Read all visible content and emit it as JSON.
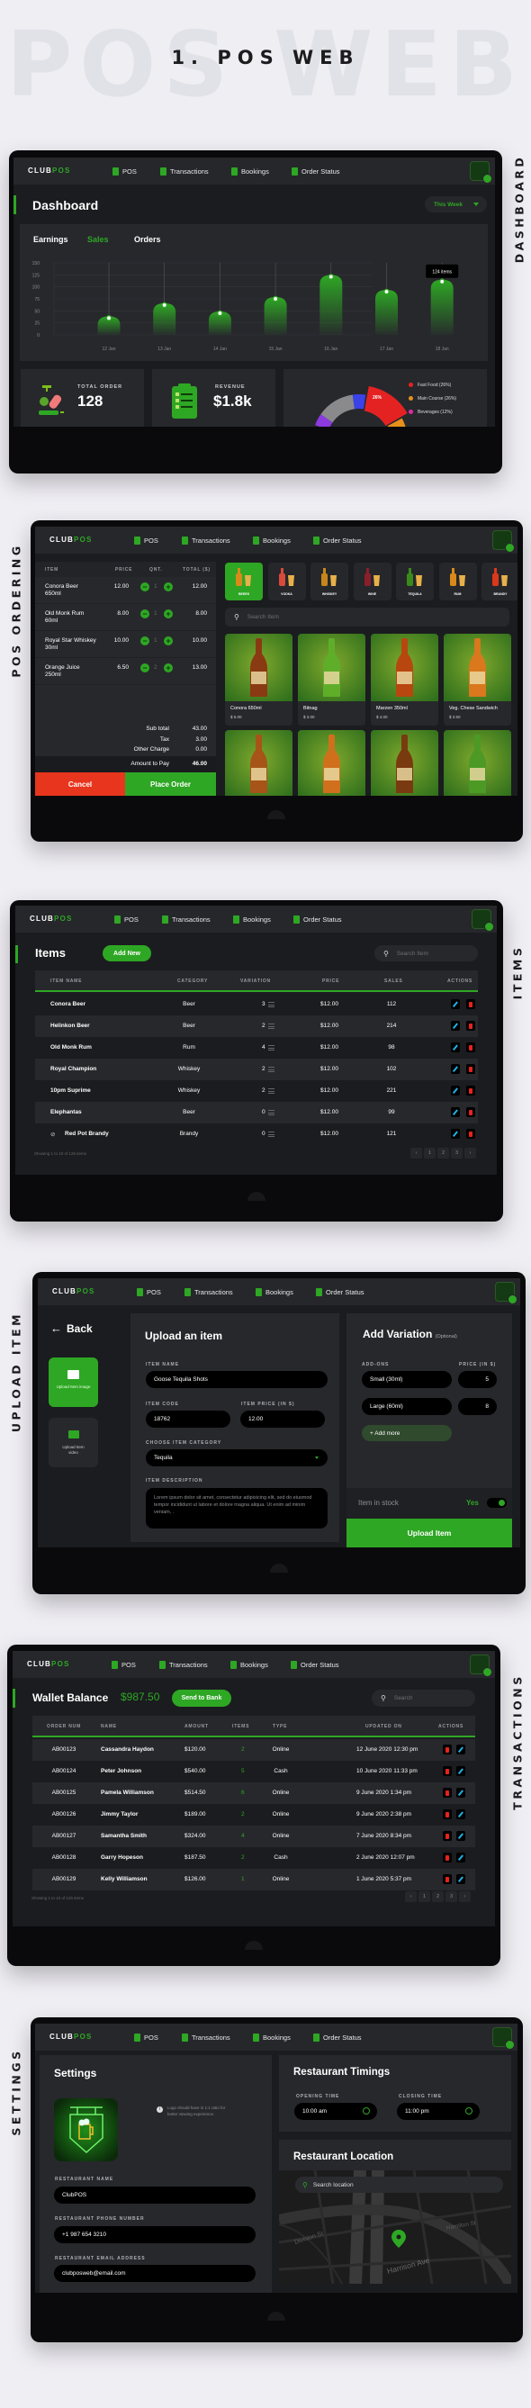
{
  "page": {
    "title": "1. POS WEB",
    "watermark": "POS WEB"
  },
  "section_labels": {
    "dashboard": "DASHBOARD",
    "ordering": "POS ORDERING",
    "items": "ITEMS",
    "upload": "UPLOAD ITEM",
    "transactions": "TRANSACTIONS",
    "settings": "SETTINGS"
  },
  "colors": {
    "accent": "#2ea724",
    "danger": "#e8351d",
    "edit": "#1fb3e8",
    "background": "#1b1c1f"
  },
  "nav": {
    "logo_a": "CLUB",
    "logo_b": "POS",
    "items": [
      {
        "label": "POS",
        "icon": "clipboard-icon"
      },
      {
        "label": "Transactions",
        "icon": "cards-icon"
      },
      {
        "label": "Bookings",
        "icon": "chair-icon"
      },
      {
        "label": "Order Status",
        "icon": "hourglass-icon"
      }
    ]
  },
  "dashboard": {
    "title": "Dashboard",
    "range": "This Week",
    "tabs": [
      "Earnings",
      "Sales",
      "Orders"
    ],
    "active_tab": "Sales",
    "tooltip": "124 items",
    "stats": {
      "total_order_label": "TOTAL ORDER",
      "total_order_value": "128",
      "revenue_label": "REVENUE",
      "revenue_value": "$1.8k"
    },
    "legend": [
      "Fast Food (26%)",
      "Main Course (26%)",
      "Beverages (12%)"
    ],
    "donut_label": "26%"
  },
  "chart_data": [
    {
      "type": "bar",
      "categories": [
        "12 Jan",
        "13 Jan",
        "14 Jan",
        "15 Jan",
        "16 Jan",
        "17 Jan",
        "18 Jan"
      ],
      "values": [
        35,
        62,
        45,
        75,
        121,
        90,
        111
      ],
      "yticks": [
        0,
        25,
        50,
        75,
        100,
        125,
        150
      ],
      "ylim": [
        0,
        150
      ],
      "grid": true,
      "annotation": {
        "category": "18 Jan",
        "text": "124 items"
      },
      "color": "#2ea724"
    },
    {
      "type": "pie",
      "donut": true,
      "legend": [
        "Fast Food (26%)",
        "Main Course (26%)",
        "Beverages (12%)"
      ],
      "legend_colors": [
        "#e52222",
        "#e8901a",
        "#e02aa8"
      ],
      "values": [
        26,
        26,
        12
      ],
      "slice_label": "26%",
      "legend_placement": "right"
    }
  ],
  "ordering": {
    "headers": [
      "ITEM",
      "PRICE",
      "QNT.",
      "TOTAL ($)"
    ],
    "rows": [
      {
        "name": "Conora Beer",
        "size": "650ml",
        "price": "12.00",
        "qty": "1",
        "total": "12.00"
      },
      {
        "name": "Old Monk Rum",
        "size": "60ml",
        "price": "8.00",
        "qty": "1",
        "total": "8.00"
      },
      {
        "name": "Royal Star Whiskey",
        "size": "30ml",
        "price": "10.00",
        "qty": "1",
        "total": "10.00"
      },
      {
        "name": "Orange Juice",
        "size": "250ml",
        "price": "6.50",
        "qty": "2",
        "total": "13.00"
      }
    ],
    "summary": [
      {
        "label": "Sub total",
        "value": "43.00"
      },
      {
        "label": "Tax",
        "value": "3.00"
      },
      {
        "label": "Other Charge",
        "value": "0.00"
      }
    ],
    "amount_label": "Amount to Pay",
    "amount_value": "46.00",
    "cancel": "Cancel",
    "place_order": "Place Order",
    "categories": [
      "BEERS",
      "VODKA",
      "WHISKEY",
      "WINE",
      "TEQUILA",
      "RUM",
      "BRANDY"
    ],
    "active_category": "BEERS",
    "search_placeholder": "Search Item",
    "products": [
      {
        "name": "Conora 650ml",
        "price": "$ 5.00",
        "color": "#8a3a12"
      },
      {
        "name": "Bitnag",
        "price": "$ 3.00",
        "color": "#5fae2a"
      },
      {
        "name": "Marzen 350ml",
        "price": "$ 4.00",
        "color": "#b8460f"
      },
      {
        "name": "Veg. Chese Sandwich",
        "price": "$ 3.50",
        "color": "#d9781c"
      },
      {
        "color": "#a65418"
      },
      {
        "color": "#d0701c"
      },
      {
        "color": "#7a3a10"
      },
      {
        "color": "#4c9a25"
      }
    ]
  },
  "items": {
    "title": "Items",
    "add_new": "Add New",
    "search_placeholder": "Search Item",
    "headers": [
      "ITEM NAME",
      "CATEGORY",
      "VARIATION",
      "PRICE",
      "SALES",
      "ACTIONS"
    ],
    "rows": [
      {
        "name": "Conora Beer",
        "category": "Beer",
        "variation": "3",
        "price": "$12.00",
        "sales": "112"
      },
      {
        "name": "Helinkon Beer",
        "category": "Beer",
        "variation": "2",
        "price": "$12.00",
        "sales": "214"
      },
      {
        "name": "Old Monk Rum",
        "category": "Rum",
        "variation": "4",
        "price": "$12.00",
        "sales": "98"
      },
      {
        "name": "Royal Champion",
        "category": "Whiskey",
        "variation": "2",
        "price": "$12.00",
        "sales": "102"
      },
      {
        "name": "10pm Suprime",
        "category": "Whiskey",
        "variation": "2",
        "price": "$12.00",
        "sales": "221"
      },
      {
        "name": "Elephantas",
        "category": "Beer",
        "variation": "0",
        "price": "$12.00",
        "sales": "99"
      },
      {
        "name": "Red Pot Brandy",
        "category": "Brandy",
        "variation": "0",
        "price": "$12.00",
        "sales": "121",
        "hidden": true
      }
    ],
    "footer": "Showing 1 to 10 of 126 items",
    "pages": [
      "1",
      "2",
      "3"
    ]
  },
  "upload": {
    "back": "Back",
    "tile_image": "Upload Item image",
    "tile_video": "Upload Item video",
    "title": "Upload an item",
    "item_name_label": "ITEM NAME",
    "item_name": "Goose Tequila Shots",
    "item_code_label": "ITEM CODE",
    "item_code": "18762",
    "item_price_label": "ITEM PRICE (IN $)",
    "item_price": "12.00",
    "category_label": "CHOOSE ITEM CATEGORY",
    "category": "Tequila",
    "description_label": "ITEM DESCRIPTION",
    "description": "Lorem ipsum dolor sit amet, consectetur adipisicing elit, sed do eiusmod tempor incididunt ut labore et dolore magna aliqua. Ut enim ad minim veniam, .",
    "variation_title": "Add Variation",
    "variation_optional": "(Optional)",
    "addons_label": "ADD-ONS",
    "addon_price_label": "PRICE (IN $)",
    "addons": [
      {
        "name": "Small (30ml)",
        "price": "5"
      },
      {
        "name": "Large (60ml)",
        "price": "8"
      }
    ],
    "add_more": "+ Add more",
    "stock_label": "Item in stock",
    "stock_value": "Yes",
    "stock_on": true,
    "submit": "Upload Item"
  },
  "transactions": {
    "title": "Wallet Balance",
    "balance": "$987.50",
    "send": "Send to Bank",
    "search_placeholder": "Search",
    "headers": [
      "ORDER NUM",
      "NAME",
      "AMOUNT",
      "ITEMS",
      "TYPE",
      "UPDATED ON",
      "ACTIONS"
    ],
    "rows": [
      {
        "order": "AB00123",
        "name": "Cassandra Haydon",
        "amount": "$120.00",
        "items": "2",
        "type": "Online",
        "updated": "12 June 2020  12:30 pm"
      },
      {
        "order": "AB00124",
        "name": "Peter Johnson",
        "amount": "$540.00",
        "items": "5",
        "type": "Cash",
        "updated": "10 June 2020  11:33 pm"
      },
      {
        "order": "AB00125",
        "name": "Pamela Williamson",
        "amount": "$514.50",
        "items": "6",
        "type": "Online",
        "updated": "9 June 2020  1:34 pm"
      },
      {
        "order": "AB00126",
        "name": "Jimmy Taylor",
        "amount": "$189.00",
        "items": "2",
        "type": "Online",
        "updated": "9 June 2020  2:38 pm"
      },
      {
        "order": "AB00127",
        "name": "Samantha Smith",
        "amount": "$324.00",
        "items": "4",
        "type": "Online",
        "updated": "7 June 2020  8:34 pm"
      },
      {
        "order": "AB00128",
        "name": "Garry Hopeson",
        "amount": "$187.50",
        "items": "2",
        "type": "Cash",
        "updated": "2 June 2020  12:07 pm"
      },
      {
        "order": "AB00129",
        "name": "Kelly Williamson",
        "amount": "$126.00",
        "items": "1",
        "type": "Online",
        "updated": "1 June 2020  5:37 pm"
      }
    ],
    "footer": "Showing 1 to 10 of 126 items",
    "pages": [
      "1",
      "2",
      "3"
    ]
  },
  "settings": {
    "title": "Settings",
    "logo_hint": "Logo should have in 1:1 ratio for better viewing experience.",
    "name_label": "RESTAURANT NAME",
    "name": "ClubPOS",
    "phone_label": "RESTAURANT PHONE NUMBER",
    "phone": "+1 987 654 3210",
    "email_label": "RESTAURANT EMAIL ADDRESS",
    "email": "clubposweb@email.com",
    "timings_title": "Restaurant Timings",
    "opening_label": "OPENING TIME",
    "opening": "10:00 am",
    "closing_label": "CLOSING TIME",
    "closing": "11:00 pm",
    "location_title": "Restaurant Location",
    "location_placeholder": "Search location",
    "streets": [
      "Division St",
      "Hamilton St",
      "Harrison Ave"
    ]
  }
}
